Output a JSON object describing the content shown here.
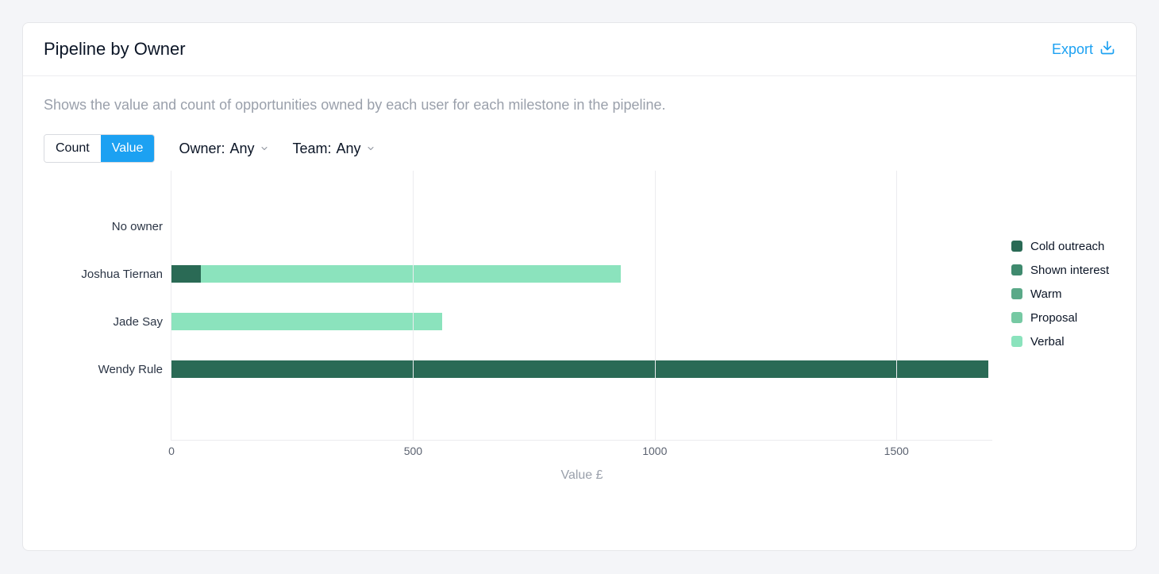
{
  "header": {
    "title": "Pipeline by Owner",
    "export_label": "Export"
  },
  "description": "Shows the value and count of opportunities owned by each user for each milestone in the pipeline.",
  "toggle": {
    "count_label": "Count",
    "value_label": "Value",
    "active": "value"
  },
  "filters": {
    "owner_label": "Owner:",
    "owner_value": "Any",
    "team_label": "Team:",
    "team_value": "Any"
  },
  "chart_data": {
    "type": "bar",
    "orientation": "horizontal",
    "stacked": true,
    "xlabel": "Value £",
    "ylabel": "",
    "xlim": [
      0,
      1700
    ],
    "x_ticks": [
      0,
      500,
      1000,
      1500
    ],
    "categories": [
      "No owner",
      "Joshua Tiernan",
      "Jade Say",
      "Wendy Rule"
    ],
    "series": [
      {
        "name": "Cold outreach",
        "color": "#2a6a55",
        "values": [
          0,
          60,
          0,
          1690
        ]
      },
      {
        "name": "Shown interest",
        "color": "#3f8a6e",
        "values": [
          0,
          0,
          0,
          0
        ]
      },
      {
        "name": "Warm",
        "color": "#5aa988",
        "values": [
          0,
          0,
          0,
          0
        ]
      },
      {
        "name": "Proposal",
        "color": "#76c9a3",
        "values": [
          0,
          0,
          0,
          0
        ]
      },
      {
        "name": "Verbal",
        "color": "#8be3bd",
        "values": [
          0,
          870,
          560,
          0
        ]
      }
    ],
    "legend_position": "right"
  }
}
